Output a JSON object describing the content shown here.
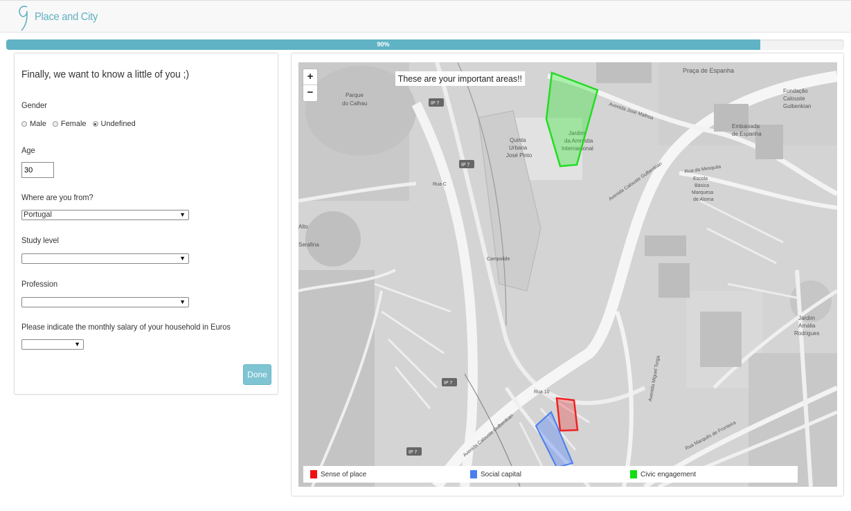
{
  "app": {
    "title": "Place and City"
  },
  "progress": {
    "label": "90%",
    "value": 0.9,
    "color": "#5fb3c4"
  },
  "form": {
    "title": "Finally, we want to know a little of you ;)",
    "gender": {
      "label": "Gender",
      "options": [
        "Male",
        "Female",
        "Undefined"
      ],
      "selected": "Undefined"
    },
    "age": {
      "label": "Age",
      "value": "30"
    },
    "origin": {
      "label": "Where are you from?",
      "value": "Portugal"
    },
    "study": {
      "label": "Study level",
      "value": ""
    },
    "profession": {
      "label": "Profession",
      "value": ""
    },
    "salary": {
      "label": "Please indicate the monthly salary of your household in Euros",
      "value": ""
    },
    "done_label": "Done"
  },
  "map": {
    "title": "These are your important areas!!",
    "zoom_in": "+",
    "zoom_out": "−",
    "labels": {
      "parque": "Parque",
      "calhau": "do Calhau",
      "quinta1": "Quinta",
      "quinta2": "Urbana",
      "quinta3": "José Pinto",
      "jardim1": "Jardim",
      "jardim2": "da Amnistia",
      "jardim3": "Internacional",
      "embaixada1": "Embaixada",
      "embaixada2": "de Espanha",
      "fundacao1": "Fundação",
      "fundacao2": "Calouste",
      "fundacao3": "Gulbenkian",
      "escola1": "Escola",
      "escola2": "Básica",
      "escola3": "Marquesa",
      "escola4": "de Alorna",
      "jardim_amalia1": "Jardim",
      "jardim_amalia2": "Amália",
      "jardim_amalia3": "Rodrigues",
      "ip7": "IP 7",
      "av_gulbenkian": "Avenida Calouste Gulbenkian",
      "campolide": "Campolide",
      "rua10": "Rua 10",
      "praca_espanha": "Praça de Espanha",
      "av_jose_malhoa": "Avenida José Malhoa",
      "rua_mesquita": "Rua da Mesquita",
      "av_miguel_torga": "Avenida Miguel Torga",
      "rua_marques_fronteira": "Rua Marquês de Fronteira",
      "alto": "Alto",
      "serafina": "Serafina",
      "rua_c": "Rua C"
    },
    "legend": [
      {
        "label": "Sense of place",
        "color": "#ee1111"
      },
      {
        "label": "Social capital",
        "color": "#4a7ff0"
      },
      {
        "label": "Civic engagement",
        "color": "#11dd11"
      }
    ]
  }
}
